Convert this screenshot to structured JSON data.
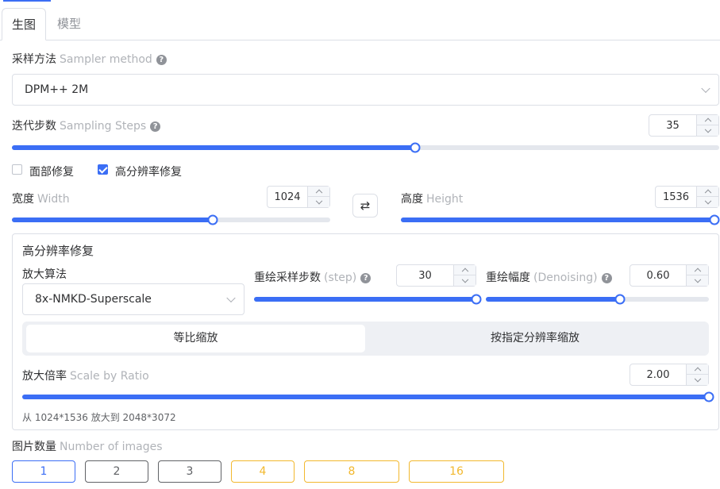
{
  "tabs": [
    {
      "label": "生图",
      "active": true
    },
    {
      "label": "模型",
      "active": false
    }
  ],
  "sampler": {
    "label": "采样方法",
    "label_en": "Sampler method",
    "value": "DPM++ 2M"
  },
  "steps": {
    "label": "迭代步数",
    "label_en": "Sampling Steps",
    "value": "35",
    "slider_fraction": 0.57
  },
  "options": {
    "face_fix": {
      "label": "面部修复",
      "checked": false
    },
    "hires_fix": {
      "label": "高分辨率修复",
      "checked": true
    }
  },
  "width": {
    "label": "宽度",
    "label_en": "Width",
    "value": "1024",
    "slider_fraction": 0.63
  },
  "swap_icon": "swap-arrows-icon",
  "height": {
    "label": "高度",
    "label_en": "Height",
    "value": "1536",
    "slider_fraction": 1.0
  },
  "hires": {
    "title": "高分辨率修复",
    "upscaler": {
      "label": "放大算法",
      "value": "8x-NMKD-Superscale"
    },
    "redraw_steps": {
      "label": "重绘采样步数",
      "label_en": "(step)",
      "value": "30",
      "slider_fraction": 1.0
    },
    "denoising": {
      "label": "重绘幅度",
      "label_en": "(Denoising)",
      "value": "0.60",
      "slider_fraction": 0.6
    },
    "mode_options": [
      {
        "label": "等比缩放",
        "active": true
      },
      {
        "label": "按指定分辨率缩放",
        "active": false
      }
    ],
    "scale": {
      "label": "放大倍率",
      "label_en": "Scale by Ratio",
      "value": "2.00",
      "slider_fraction": 1.0
    },
    "note": "从 1024*1536 放大到 2048*3072"
  },
  "images": {
    "label": "图片数量",
    "label_en": "Number of images",
    "options": [
      "1",
      "2",
      "3",
      "4",
      "8",
      "16"
    ],
    "selected": "1"
  },
  "colors": {
    "accent": "#3b6ef5",
    "warning": "#f2b82e"
  }
}
